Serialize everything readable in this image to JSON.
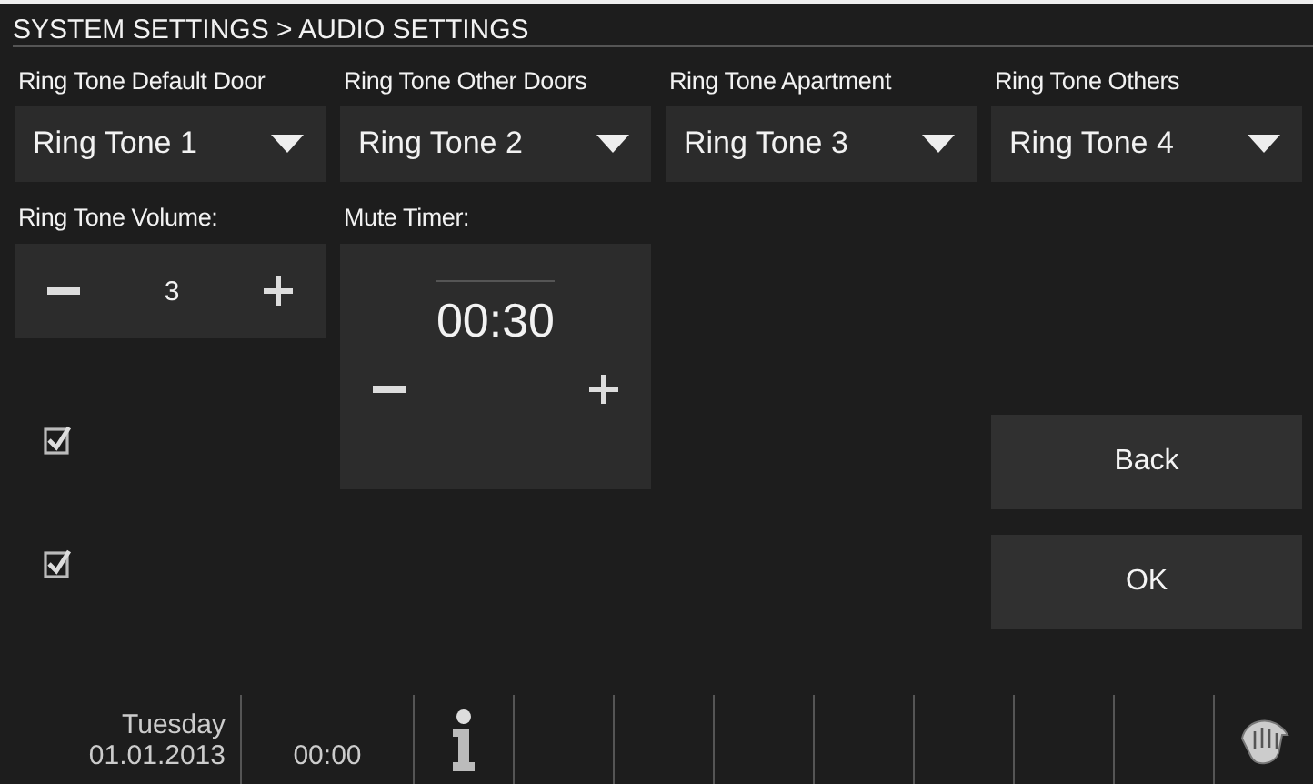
{
  "header": {
    "title": "SYSTEM SETTINGS > AUDIO SETTINGS"
  },
  "ringtones": [
    {
      "label": "Ring Tone Default Door",
      "value": "Ring Tone 1"
    },
    {
      "label": "Ring Tone Other Doors",
      "value": "Ring Tone 2"
    },
    {
      "label": "Ring Tone Apartment",
      "value": "Ring Tone 3"
    },
    {
      "label": "Ring Tone Others",
      "value": "Ring Tone 4"
    }
  ],
  "volume": {
    "label": "Ring Tone Volume:",
    "value": "3"
  },
  "mute_timer": {
    "label": "Mute Timer:",
    "value": "00:30"
  },
  "checkboxes": [
    {
      "checked": true
    },
    {
      "checked": true
    }
  ],
  "buttons": [
    "Back",
    "OK"
  ],
  "status_bar": {
    "day": "Tuesday",
    "date": "01.01.2013",
    "time": "00:00"
  }
}
